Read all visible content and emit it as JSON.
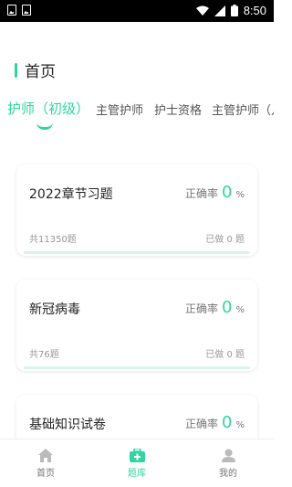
{
  "status_bar": {
    "time": "8:50"
  },
  "header": {
    "title": "首页"
  },
  "tabs": [
    {
      "label": "护师（初级）"
    },
    {
      "label": "主管护师"
    },
    {
      "label": "护士资格"
    },
    {
      "label": "主管护师（儿科）"
    }
  ],
  "cards": [
    {
      "title": "2022章节习题",
      "accuracy_label": "正确率",
      "accuracy_value": "0",
      "accuracy_unit": "%",
      "total": "共11350题",
      "done": "已做 0 题",
      "progress": 0
    },
    {
      "title": "新冠病毒",
      "accuracy_label": "正确率",
      "accuracy_value": "0",
      "accuracy_unit": "%",
      "total": "共76题",
      "done": "已做 0 题",
      "progress": 0
    },
    {
      "title": "基础知识试卷",
      "accuracy_label": "正确率",
      "accuracy_value": "0",
      "accuracy_unit": "%"
    }
  ],
  "bottom_nav": [
    {
      "label": "首页",
      "icon": "home-icon"
    },
    {
      "label": "题库",
      "icon": "medical-kit-icon",
      "active": true
    },
    {
      "label": "我的",
      "icon": "profile-icon"
    }
  ],
  "colors": {
    "accent": "#2fd6a0",
    "muted": "#999999"
  }
}
